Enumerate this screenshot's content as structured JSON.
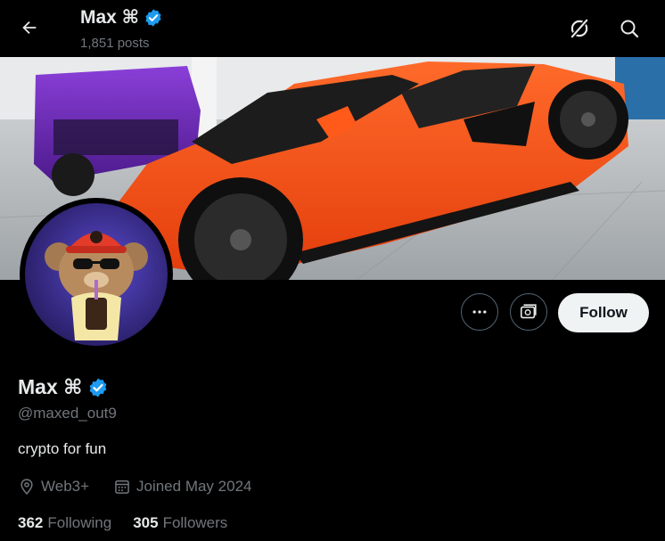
{
  "header": {
    "name": "Max ⌘",
    "posts": "1,851 posts"
  },
  "profile": {
    "name": "Max ⌘",
    "handle": "@maxed_out9",
    "bio": "crypto for fun",
    "location": "Web3+",
    "joined": "Joined May 2024",
    "following_count": "362",
    "following_label": "Following",
    "followers_count": "305",
    "followers_label": "Followers"
  },
  "actions": {
    "follow_label": "Follow"
  },
  "icons": {
    "back": "arrow-left-icon",
    "grok": "grok-icon",
    "search": "search-icon",
    "verified": "verified-badge-icon",
    "more": "more-icon",
    "subscribe": "subscribe-icon",
    "location": "location-pin-icon",
    "calendar": "calendar-icon"
  },
  "colors": {
    "background": "#000000",
    "verified": "#1d9bf0",
    "secondary_text": "#71767b",
    "follow_button_bg": "#eff3f4"
  }
}
